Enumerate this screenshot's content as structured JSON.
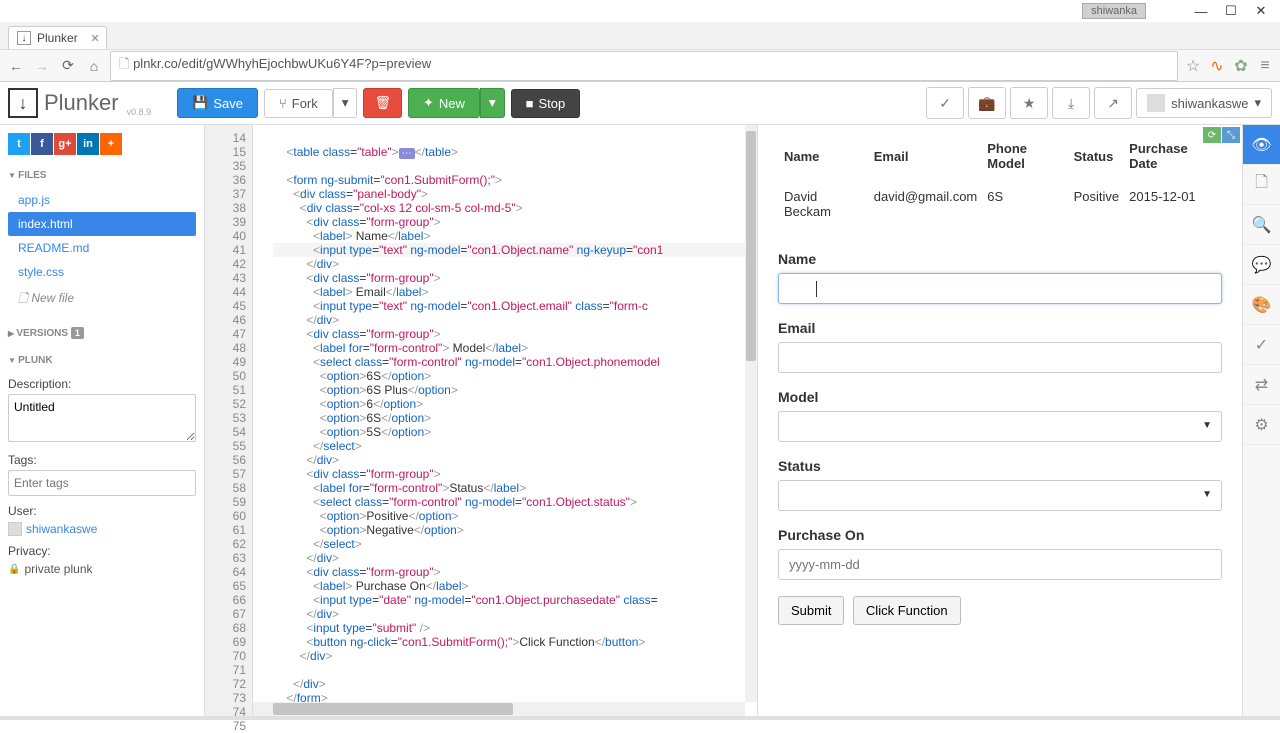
{
  "window": {
    "user": "shiwanka"
  },
  "browser": {
    "tab_title": "Plunker",
    "url": "plnkr.co/edit/gWWhyhEjochbwUKu6Y4F?p=preview"
  },
  "toolbar": {
    "brand": "Plunker",
    "version": "v0.8.9",
    "save": "Save",
    "fork": "Fork",
    "new": "New",
    "stop": "Stop",
    "user": "shiwankaswe"
  },
  "sidebar": {
    "files_label": "FILES",
    "files": [
      {
        "name": "app.js"
      },
      {
        "name": "index.html"
      },
      {
        "name": "README.md"
      },
      {
        "name": "style.css"
      }
    ],
    "new_file": "New file",
    "versions_label": "VERSIONS",
    "versions_badge": "1",
    "plunk_label": "PLUNK",
    "description_label": "Description:",
    "description_value": "Untitled",
    "tags_label": "Tags:",
    "tags_placeholder": "Enter tags",
    "user_label": "User:",
    "user_value": "shiwankaswe",
    "privacy_label": "Privacy:",
    "privacy_value": "private plunk"
  },
  "editor": {
    "lines": [
      {
        "n": 14,
        "html": ""
      },
      {
        "n": 15,
        "html": "    <span class='br'>&lt;</span><span class='tag'>table</span> <span class='attr'>class</span>=<span class='str'>\"table\"</span><span class='br'>&gt;</span><span class='fold-mark'>⋯</span><span class='br'>&lt;/</span><span class='tag'>table</span><span class='br'>&gt;</span>"
      },
      {
        "n": 35,
        "html": ""
      },
      {
        "n": 36,
        "html": "    <span class='br'>&lt;</span><span class='tag'>form</span> <span class='attr'>ng-submit</span>=<span class='str'>\"con1.SubmitForm();\"</span><span class='br'>&gt;</span>"
      },
      {
        "n": 37,
        "html": "      <span class='br'>&lt;</span><span class='tag'>div</span> <span class='attr'>class</span>=<span class='str'>\"panel-body\"</span><span class='br'>&gt;</span>"
      },
      {
        "n": 38,
        "html": "        <span class='br'>&lt;</span><span class='tag'>div</span> <span class='attr'>class</span>=<span class='str'>\"col-xs 12 col-sm-5 col-md-5\"</span><span class='br'>&gt;</span>"
      },
      {
        "n": 39,
        "html": "          <span class='br'>&lt;</span><span class='tag'>div</span> <span class='attr'>class</span>=<span class='str'>\"form-group\"</span><span class='br'>&gt;</span>"
      },
      {
        "n": 40,
        "html": "            <span class='br'>&lt;</span><span class='tag'>label</span><span class='br'>&gt;</span> Name<span class='br'>&lt;/</span><span class='tag'>label</span><span class='br'>&gt;</span>"
      },
      {
        "n": 41,
        "html": "            <span class='br'>&lt;</span><span class='tag'>input</span> <span class='attr'>type</span>=<span class='str'>\"text\"</span> <span class='attr'>ng-model</span>=<span class='str'>\"con1.Object.name\"</span> <span class='attr'>ng-keyup</span>=<span class='str'>\"con1</span>",
        "hl": true
      },
      {
        "n": 42,
        "html": "          <span class='br'>&lt;/</span><span class='tag'>div</span><span class='br'>&gt;</span>"
      },
      {
        "n": 43,
        "html": "          <span class='br'>&lt;</span><span class='tag'>div</span> <span class='attr'>class</span>=<span class='str'>\"form-group\"</span><span class='br'>&gt;</span>"
      },
      {
        "n": 44,
        "html": "            <span class='br'>&lt;</span><span class='tag'>label</span><span class='br'>&gt;</span> Email<span class='br'>&lt;/</span><span class='tag'>label</span><span class='br'>&gt;</span>"
      },
      {
        "n": 45,
        "html": "            <span class='br'>&lt;</span><span class='tag'>input</span> <span class='attr'>type</span>=<span class='str'>\"text\"</span> <span class='attr'>ng-model</span>=<span class='str'>\"con1.Object.email\"</span> <span class='attr'>class</span>=<span class='str'>\"form-c</span>"
      },
      {
        "n": 46,
        "html": "          <span class='br'>&lt;/</span><span class='tag'>div</span><span class='br'>&gt;</span>"
      },
      {
        "n": 47,
        "html": "          <span class='br'>&lt;</span><span class='tag'>div</span> <span class='attr'>class</span>=<span class='str'>\"form-group\"</span><span class='br'>&gt;</span>"
      },
      {
        "n": 48,
        "html": "            <span class='br'>&lt;</span><span class='tag'>label</span> <span class='attr'>for</span>=<span class='str'>\"form-control\"</span><span class='br'>&gt;</span> Model<span class='br'>&lt;/</span><span class='tag'>label</span><span class='br'>&gt;</span>"
      },
      {
        "n": 49,
        "html": "            <span class='br'>&lt;</span><span class='tag'>select</span> <span class='attr'>class</span>=<span class='str'>\"form-control\"</span> <span class='attr'>ng-model</span>=<span class='str'>\"con1.Object.phonemodel</span>"
      },
      {
        "n": 50,
        "html": "              <span class='br'>&lt;</span><span class='tag'>option</span><span class='br'>&gt;</span>6S<span class='br'>&lt;/</span><span class='tag'>option</span><span class='br'>&gt;</span>"
      },
      {
        "n": 51,
        "html": "              <span class='br'>&lt;</span><span class='tag'>option</span><span class='br'>&gt;</span>6S Plus<span class='br'>&lt;/</span><span class='tag'>option</span><span class='br'>&gt;</span>"
      },
      {
        "n": 52,
        "html": "              <span class='br'>&lt;</span><span class='tag'>option</span><span class='br'>&gt;</span>6<span class='br'>&lt;/</span><span class='tag'>option</span><span class='br'>&gt;</span>"
      },
      {
        "n": 53,
        "html": "              <span class='br'>&lt;</span><span class='tag'>option</span><span class='br'>&gt;</span>6S<span class='br'>&lt;/</span><span class='tag'>option</span><span class='br'>&gt;</span>"
      },
      {
        "n": 54,
        "html": "              <span class='br'>&lt;</span><span class='tag'>option</span><span class='br'>&gt;</span>5S<span class='br'>&lt;/</span><span class='tag'>option</span><span class='br'>&gt;</span>"
      },
      {
        "n": 55,
        "html": "            <span class='br'>&lt;/</span><span class='tag'>select</span><span class='br'>&gt;</span>"
      },
      {
        "n": 56,
        "html": "          <span class='br'>&lt;/</span><span class='tag'>div</span><span class='br'>&gt;</span>"
      },
      {
        "n": 57,
        "html": "          <span class='br'>&lt;</span><span class='tag'>div</span> <span class='attr'>class</span>=<span class='str'>\"form-group\"</span><span class='br'>&gt;</span>"
      },
      {
        "n": 58,
        "html": "            <span class='br'>&lt;</span><span class='tag'>label</span> <span class='attr'>for</span>=<span class='str'>\"form-control\"</span><span class='br'>&gt;</span>Status<span class='br'>&lt;/</span><span class='tag'>label</span><span class='br'>&gt;</span>"
      },
      {
        "n": 59,
        "html": "            <span class='br'>&lt;</span><span class='tag'>select</span> <span class='attr'>class</span>=<span class='str'>\"form-control\"</span> <span class='attr'>ng-model</span>=<span class='str'>\"con1.Object.status\"</span><span class='br'>&gt;</span>"
      },
      {
        "n": 60,
        "html": "              <span class='br'>&lt;</span><span class='tag'>option</span><span class='br'>&gt;</span>Positive<span class='br'>&lt;/</span><span class='tag'>option</span><span class='br'>&gt;</span>"
      },
      {
        "n": 61,
        "html": "              <span class='br'>&lt;</span><span class='tag'>option</span><span class='br'>&gt;</span>Negative<span class='br'>&lt;/</span><span class='tag'>option</span><span class='br'>&gt;</span>"
      },
      {
        "n": 62,
        "html": "            <span class='br'>&lt;/</span><span class='tag'>select</span><span class='br'>&gt;</span>"
      },
      {
        "n": 63,
        "html": "          <span class='br'>&lt;/</span><span class='tag'>div</span><span class='br'>&gt;</span>"
      },
      {
        "n": 64,
        "html": "          <span class='br'>&lt;</span><span class='tag'>div</span> <span class='attr'>class</span>=<span class='str'>\"form-group\"</span><span class='br'>&gt;</span>"
      },
      {
        "n": 65,
        "html": "            <span class='br'>&lt;</span><span class='tag'>label</span><span class='br'>&gt;</span> Purchase On<span class='br'>&lt;/</span><span class='tag'>label</span><span class='br'>&gt;</span>"
      },
      {
        "n": 66,
        "html": "            <span class='br'>&lt;</span><span class='tag'>input</span> <span class='attr'>type</span>=<span class='str'>\"date\"</span> <span class='attr'>ng-model</span>=<span class='str'>\"con1.Object.purchasedate\"</span> <span class='attr'>class</span>="
      },
      {
        "n": 67,
        "html": "          <span class='br'>&lt;/</span><span class='tag'>div</span><span class='br'>&gt;</span>"
      },
      {
        "n": 68,
        "html": "          <span class='br'>&lt;</span><span class='tag'>input</span> <span class='attr'>type</span>=<span class='str'>\"submit\"</span> <span class='br'>/&gt;</span>"
      },
      {
        "n": 69,
        "html": "          <span class='br'>&lt;</span><span class='tag'>button</span> <span class='attr'>ng-click</span>=<span class='str'>\"con1.SubmitForm();\"</span><span class='br'>&gt;</span>Click Function<span class='br'>&lt;/</span><span class='tag'>button</span><span class='br'>&gt;</span>"
      },
      {
        "n": 70,
        "html": "        <span class='br'>&lt;/</span><span class='tag'>div</span><span class='br'>&gt;</span>"
      },
      {
        "n": 71,
        "html": ""
      },
      {
        "n": 72,
        "html": "      <span class='br'>&lt;/</span><span class='tag'>div</span><span class='br'>&gt;</span>"
      },
      {
        "n": 73,
        "html": "    <span class='br'>&lt;/</span><span class='tag'>form</span><span class='br'>&gt;</span>"
      },
      {
        "n": 74,
        "html": ""
      },
      {
        "n": 75,
        "html": ""
      }
    ]
  },
  "preview": {
    "table": {
      "headers": [
        "Name",
        "Email",
        "Phone Model",
        "Status",
        "Purchase Date"
      ],
      "rows": [
        {
          "name": "David Beckam",
          "email": "david@gmail.com",
          "model": "6S",
          "status": "Positive",
          "date": "2015-12-01"
        }
      ]
    },
    "form": {
      "name_label": "Name",
      "email_label": "Email",
      "model_label": "Model",
      "status_label": "Status",
      "purchase_label": "Purchase On",
      "date_placeholder": "yyyy-mm-dd",
      "submit": "Submit",
      "click_fn": "Click Function"
    }
  }
}
